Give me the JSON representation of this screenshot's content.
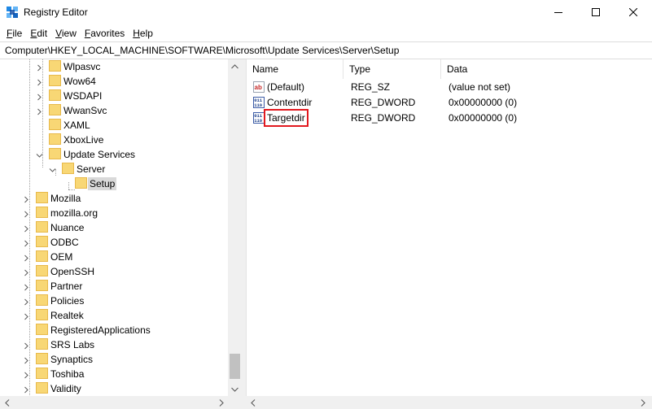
{
  "window": {
    "title": "Registry Editor",
    "icon": "registry-editor-icon",
    "controls": [
      "minimize-icon",
      "maximize-icon",
      "close-icon"
    ]
  },
  "menu": [
    {
      "accel": "F",
      "rest": "ile"
    },
    {
      "accel": "E",
      "rest": "dit"
    },
    {
      "accel": "V",
      "rest": "iew"
    },
    {
      "accel": "F",
      "rest": "avorites",
      "prefix": ""
    },
    {
      "accel": "H",
      "rest": "elp"
    }
  ],
  "address": "Computer\\HKEY_LOCAL_MACHINE\\SOFTWARE\\Microsoft\\Update Services\\Server\\Setup",
  "tree": {
    "items": [
      {
        "label": "Wlpasvc",
        "level": 3,
        "expander": "collapsed"
      },
      {
        "label": "Wow64",
        "level": 3,
        "expander": "collapsed"
      },
      {
        "label": "WSDAPI",
        "level": 3,
        "expander": "collapsed"
      },
      {
        "label": "WwanSvc",
        "level": 3,
        "expander": "collapsed"
      },
      {
        "label": "XAML",
        "level": 3,
        "expander": "none"
      },
      {
        "label": "XboxLive",
        "level": 3,
        "expander": "none"
      },
      {
        "label": "Update Services",
        "level": 3,
        "expander": "expanded"
      },
      {
        "label": "Server",
        "level": 4,
        "expander": "expanded"
      },
      {
        "label": "Setup",
        "level": 5,
        "expander": "none",
        "selected": true
      },
      {
        "label": "Mozilla",
        "level": 2,
        "expander": "collapsed"
      },
      {
        "label": "mozilla.org",
        "level": 2,
        "expander": "collapsed"
      },
      {
        "label": "Nuance",
        "level": 2,
        "expander": "collapsed"
      },
      {
        "label": "ODBC",
        "level": 2,
        "expander": "collapsed"
      },
      {
        "label": "OEM",
        "level": 2,
        "expander": "collapsed"
      },
      {
        "label": "OpenSSH",
        "level": 2,
        "expander": "collapsed"
      },
      {
        "label": "Partner",
        "level": 2,
        "expander": "collapsed"
      },
      {
        "label": "Policies",
        "level": 2,
        "expander": "collapsed"
      },
      {
        "label": "Realtek",
        "level": 2,
        "expander": "collapsed"
      },
      {
        "label": "RegisteredApplications",
        "level": 2,
        "expander": "none"
      },
      {
        "label": "SRS Labs",
        "level": 2,
        "expander": "collapsed"
      },
      {
        "label": "Synaptics",
        "level": 2,
        "expander": "collapsed"
      },
      {
        "label": "Toshiba",
        "level": 2,
        "expander": "collapsed"
      },
      {
        "label": "Validity",
        "level": 2,
        "expander": "collapsed"
      }
    ],
    "scroll_position": 0.9
  },
  "values": {
    "columns": [
      "Name",
      "Type",
      "Data"
    ],
    "rows": [
      {
        "icon": "string-value-icon",
        "name": "(Default)",
        "type": "REG_SZ",
        "data": "(value not set)",
        "highlighted": false
      },
      {
        "icon": "binary-value-icon",
        "name": "Contentdir",
        "type": "REG_DWORD",
        "data": "0x00000000 (0)",
        "highlighted": false
      },
      {
        "icon": "binary-value-icon",
        "name": "Targetdir",
        "type": "REG_DWORD",
        "data": "0x00000000 (0)",
        "highlighted": true
      }
    ]
  },
  "colors": {
    "folder": "#f8d775",
    "folder_dark": "#e8b94a",
    "highlight_box": "#e2191f",
    "selection": "#d9d9d9"
  }
}
